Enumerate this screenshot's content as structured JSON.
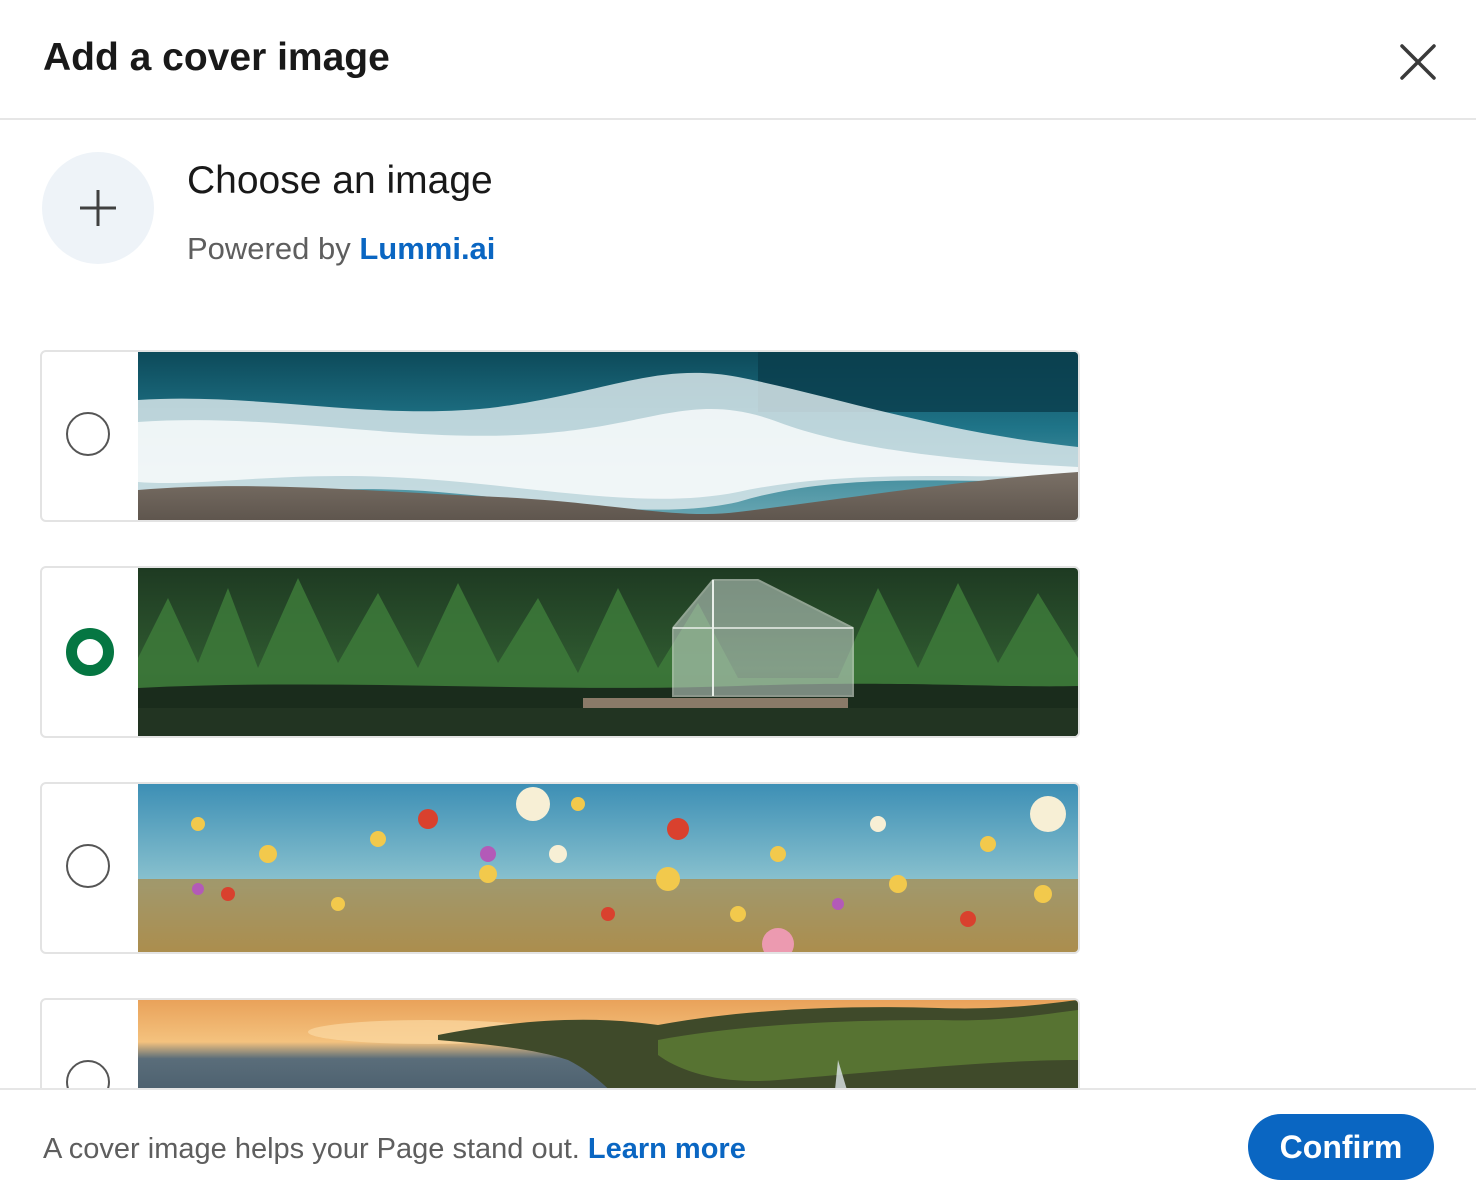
{
  "header": {
    "title": "Add a cover image",
    "close_icon": "close-icon"
  },
  "chooser": {
    "add_icon": "plus-icon",
    "title": "Choose an image",
    "powered_prefix": "Powered by ",
    "brand": "Lummi.ai"
  },
  "options": [
    {
      "name": "ocean-waves",
      "selected": false
    },
    {
      "name": "forest-glass-cabin",
      "selected": true
    },
    {
      "name": "wildflower-meadow",
      "selected": false
    },
    {
      "name": "coastal-sunset-cliffs",
      "selected": false
    }
  ],
  "footer": {
    "text": "A cover image helps your Page stand out. ",
    "learn_more": "Learn more",
    "confirm": "Confirm"
  },
  "colors": {
    "accent": "#0a66c2",
    "selected_radio": "#057642",
    "add_circle_bg": "#eef3f8"
  }
}
